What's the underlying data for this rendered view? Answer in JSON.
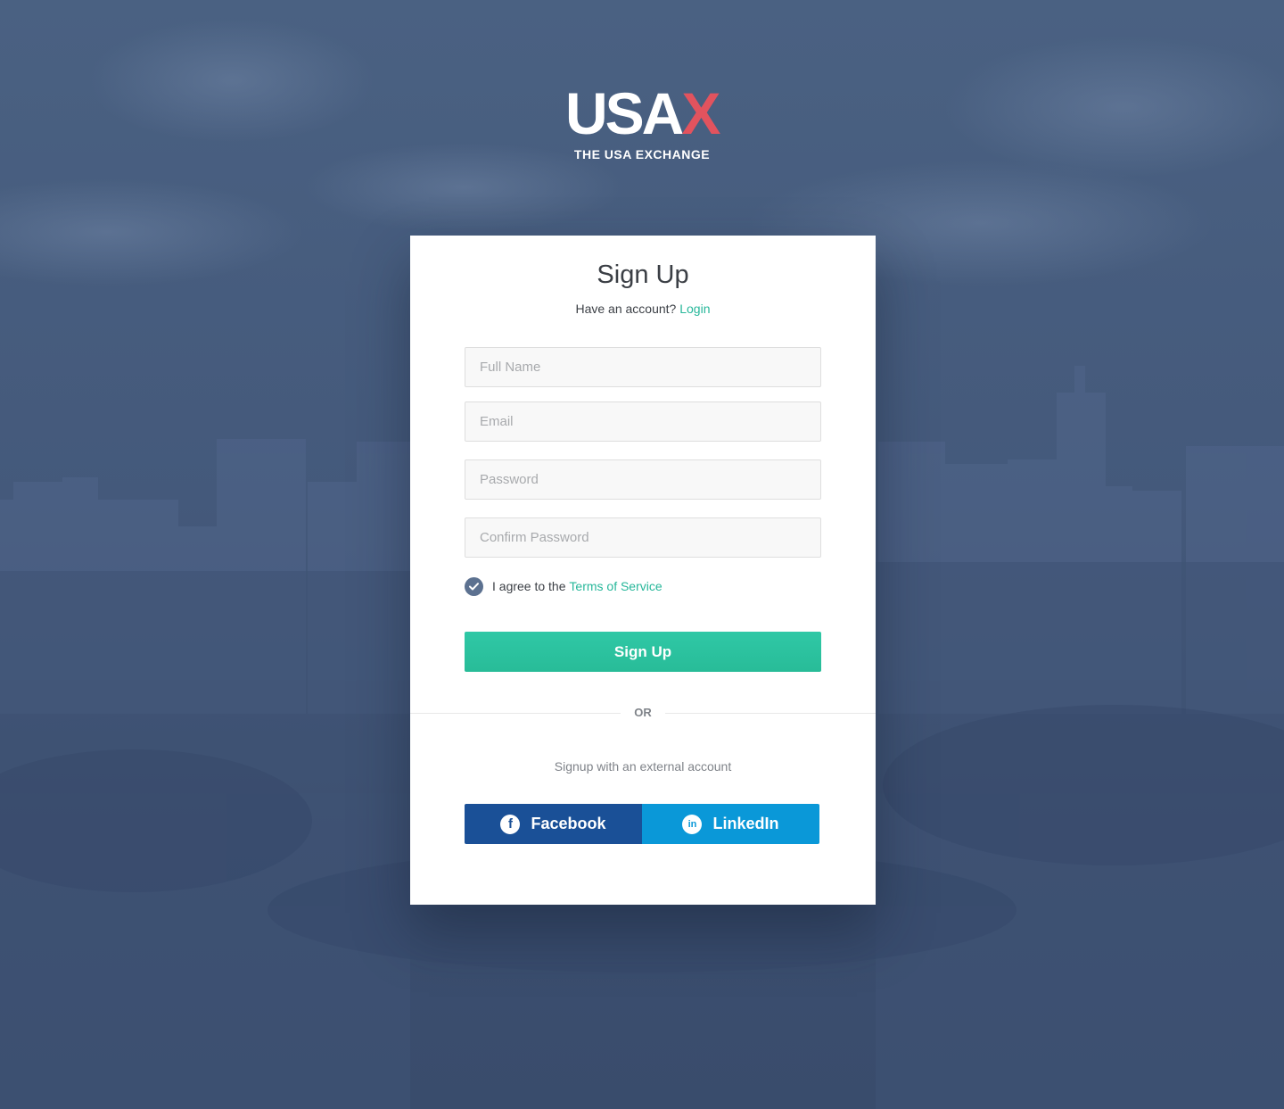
{
  "brand": {
    "logo_main": "USA",
    "logo_accent": "X",
    "tagline": "THE USA EXCHANGE"
  },
  "form": {
    "title": "Sign Up",
    "have_account": "Have an account?",
    "login_link": "Login",
    "fields": {
      "full_name_placeholder": "Full Name",
      "email_placeholder": "Email",
      "password_placeholder": "Password",
      "confirm_password_placeholder": "Confirm Password"
    },
    "terms_prefix": "I agree to the",
    "terms_link": "Terms of Service",
    "terms_checked": true,
    "submit_label": "Sign Up"
  },
  "divider": {
    "label": "OR"
  },
  "external": {
    "prompt": "Signup with an external account",
    "facebook_label": "Facebook",
    "linkedin_label": "LinkedIn"
  },
  "colors": {
    "accent": "#2fc8a6",
    "facebook": "#1a5097",
    "linkedin": "#0a98d8",
    "logo_accent": "#e2535e"
  }
}
